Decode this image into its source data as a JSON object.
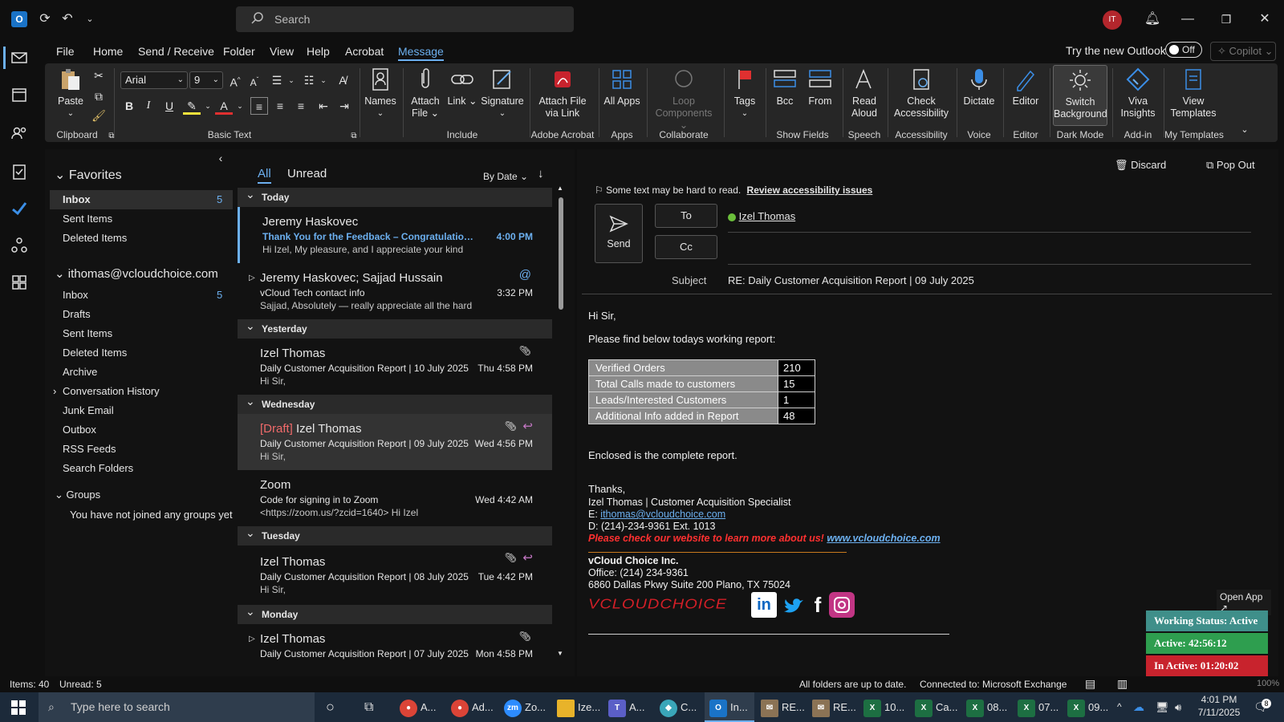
{
  "titlebar": {
    "search_placeholder": "Search",
    "avatar_initials": "IT"
  },
  "menu": {
    "items": [
      "File",
      "Home",
      "Send / Receive",
      "Folder",
      "View",
      "Help",
      "Acrobat",
      "Message"
    ],
    "active": "Message",
    "try_new": "Try the new Outlook",
    "toggle": "Off",
    "copilot": "Copilot"
  },
  "ribbon": {
    "paste": "Paste",
    "font_name": "Arial",
    "font_size": "9",
    "groups": {
      "clipboard": "Clipboard",
      "basic_text": "Basic Text",
      "include": "Include",
      "adobe": "Adobe Acrobat",
      "apps": "Apps",
      "collaborate": "Collaborate",
      "show_fields": "Show Fields",
      "speech": "Speech",
      "accessibility": "Accessibility",
      "voice": "Voice",
      "editor": "Editor",
      "dark_mode": "Dark Mode",
      "addin": "Add-in",
      "templates": "My Templates"
    },
    "buttons": {
      "names": "Names",
      "attach_file": "Attach File",
      "link": "Link",
      "signature": "Signature",
      "attach_acrobat": "Attach File via Link",
      "all_apps": "All Apps",
      "loop": "Loop Components",
      "tags": "Tags",
      "bcc": "Bcc",
      "from": "From",
      "read_aloud": "Read Aloud",
      "check_acc": "Check Accessibility",
      "dictate": "Dictate",
      "editor": "Editor",
      "switch_bg": "Switch Background",
      "viva": "Viva Insights",
      "view_templates": "View Templates"
    }
  },
  "folders": {
    "favorites": "Favorites",
    "fav_items": [
      {
        "label": "Inbox",
        "count": "5"
      },
      {
        "label": "Sent Items",
        "count": ""
      },
      {
        "label": "Deleted Items",
        "count": ""
      }
    ],
    "account": "ithomas@vcloudchoice.com",
    "acc_items": [
      {
        "label": "Inbox",
        "count": "5"
      },
      {
        "label": "Drafts",
        "count": ""
      },
      {
        "label": "Sent Items",
        "count": ""
      },
      {
        "label": "Deleted Items",
        "count": ""
      },
      {
        "label": "Archive",
        "count": ""
      },
      {
        "label": "Conversation History",
        "count": ""
      },
      {
        "label": "Junk Email",
        "count": ""
      },
      {
        "label": "Outbox",
        "count": ""
      },
      {
        "label": "RSS Feeds",
        "count": ""
      },
      {
        "label": "Search Folders",
        "count": ""
      }
    ],
    "groups": "Groups",
    "groups_note": "You have not joined any groups yet"
  },
  "list": {
    "tab_all": "All",
    "tab_unread": "Unread",
    "sort": "By Date",
    "days": [
      "Today",
      "Yesterday",
      "Wednesday",
      "Tuesday",
      "Monday"
    ],
    "mails": [
      {
        "sender": "Jeremy Haskovec",
        "subject": "Thank You for the Feedback – Congratulations o...",
        "preview": "Hi Izel,  My pleasure, and I appreciate your kind",
        "time": "4:00 PM"
      },
      {
        "sender": "Jeremy Haskovec;  Sajjad Hussain",
        "subject": "vCloud Tech contact info",
        "preview": "Sajjad,    Absolutely — really appreciate all the hard",
        "time": "3:32 PM"
      },
      {
        "sender": "Izel Thomas",
        "subject": "Daily Customer Acquisition Report | 10 July 2025",
        "preview": "Hi Sir,",
        "time": "Thu 4:58 PM"
      },
      {
        "draft": "[Draft]",
        "sender": "Izel Thomas",
        "subject": "Daily Customer Acquisition Report | 09 July 2025",
        "preview": "Hi Sir,",
        "time": "Wed 4:56 PM"
      },
      {
        "sender": "Zoom",
        "subject": "Code for signing in to Zoom",
        "preview": "<https://zoom.us/?zcid=1640>          Hi Izel",
        "time": "Wed 4:42 AM"
      },
      {
        "sender": "Izel Thomas",
        "subject": "Daily Customer Acquisition Report | 08 July 2025",
        "preview": "Hi Sir,",
        "time": "Tue 4:42 PM"
      },
      {
        "sender": "Izel Thomas",
        "subject": "Daily Customer Acquisition Report | 07 July 2025",
        "preview": "",
        "time": "Mon 4:58 PM"
      }
    ]
  },
  "reading": {
    "discard": "Discard",
    "popout": "Pop Out",
    "acc_note": "Some text may be hard to read.",
    "acc_link": "Review accessibility issues",
    "send": "Send",
    "to": "To",
    "cc": "Cc",
    "to_value": "Izel Thomas",
    "subject_label": "Subject",
    "subject_value": "RE: Daily Customer Acquisition Report | 09 July 2025",
    "greeting": "Hi Sir,",
    "intro": "Please find below todays working report:",
    "table": [
      {
        "label": "Verified Orders",
        "value": "210"
      },
      {
        "label": "Total Calls made to customers",
        "value": "15"
      },
      {
        "label": "Leads/Interested Customers",
        "value": "1"
      },
      {
        "label": "Additional Info added in Report",
        "value": "48"
      }
    ],
    "enclosed": "Enclosed is the complete report.",
    "thanks": "Thanks,",
    "sig_name": "Izel Thomas | Customer Acquisition Specialist",
    "sig_email_label": "E: ",
    "sig_email": "ithomas@vcloudchoice.com",
    "sig_phone": "D: (214)-234-9361 Ext. 1013",
    "sig_web_text": "Please check our website to learn more about us! ",
    "sig_web": "www.vcloudchoice.com",
    "company": "vCloud Choice Inc.",
    "office": "Office: (214) 234-9361",
    "address": "6860 Dallas Pkwy Suite 200 Plano, TX 75024",
    "logo": "VCLOUDCHOICE"
  },
  "widget": {
    "open_app": "Open App ↗",
    "status": "Working Status: Active",
    "active": "Active: 42:56:12",
    "inactive": "In Active: 01:20:02"
  },
  "status": {
    "items": "Items: 40",
    "unread": "Unread: 5",
    "sync": "All folders are up to date.",
    "conn": "Connected to: Microsoft Exchange",
    "zoom": "100%"
  },
  "taskbar": {
    "search": "Type here to search",
    "apps": [
      "A...",
      "Ad...",
      "Zo...",
      "Ize...",
      "A...",
      "C...",
      "In...",
      "RE...",
      "RE...",
      "10...",
      "Ca...",
      "08...",
      "07...",
      "09..."
    ],
    "time": "4:01 PM",
    "date": "7/11/2025",
    "notif": "8"
  },
  "colors": {
    "accent": "#6cb0f0",
    "brand_red": "#d21f27",
    "active_green": "#2e9e4f",
    "inactive_red": "#c8232d",
    "status_teal": "#3f8f8a"
  }
}
